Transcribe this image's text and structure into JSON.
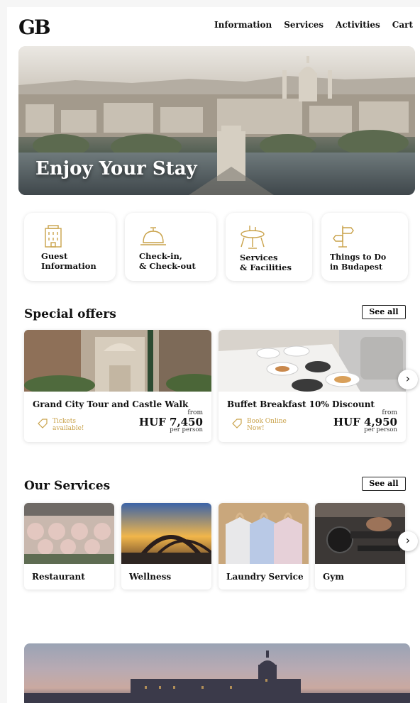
{
  "header": {
    "logo": "GB",
    "nav": [
      "Information",
      "Services",
      "Activities",
      "Cart"
    ]
  },
  "hero": {
    "title": "Enjoy Your Stay",
    "image": "budapest-city-panorama"
  },
  "quick_links": [
    {
      "label": "Guest\nInformation",
      "icon": "building-icon"
    },
    {
      "label": "Check-in,\n& Check-out",
      "icon": "reception-bell-icon"
    },
    {
      "label": "Services\n& Facilities",
      "icon": "dining-table-icon"
    },
    {
      "label": "Things to Do\nin Budapest",
      "icon": "signpost-icon"
    }
  ],
  "special_offers": {
    "title": "Special offers",
    "see_all": "See all",
    "items": [
      {
        "title": "Grand City Tour and Castle Walk",
        "badge": "Tickets available!",
        "from": "from",
        "price": "HUF 7,450",
        "per": "per person"
      },
      {
        "title": "Buffet Breakfast 10% Discount",
        "badge": "Book Online Now!",
        "from": "from",
        "price": "HUF 4,950",
        "per": "per person"
      }
    ]
  },
  "our_services": {
    "title": "Our Services",
    "see_all": "See all",
    "items": [
      {
        "label": "Restaurant"
      },
      {
        "label": "Wellness"
      },
      {
        "label": "Laundry Service"
      },
      {
        "label": "Gym"
      }
    ]
  },
  "icons": {
    "next": "chevron-right-icon",
    "tag": "ticket-tag-icon"
  },
  "colors": {
    "accent_gold": "#c9a24a",
    "text": "#111111",
    "card_bg": "#ffffff"
  }
}
